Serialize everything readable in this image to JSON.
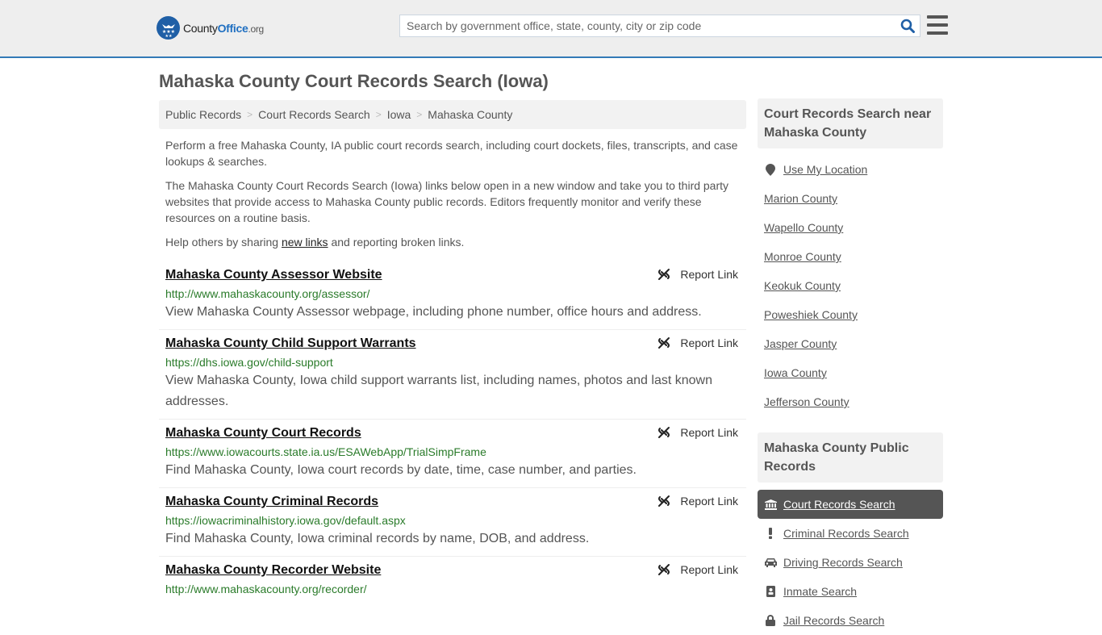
{
  "header": {
    "logo": {
      "county": "County",
      "office": "Office",
      "org": ".org"
    },
    "search": {
      "placeholder": "Search by government office, state, county, city or zip code",
      "value": ""
    },
    "colors": {
      "accent": "#337ab7",
      "logo_blue": "#1f5fa6"
    }
  },
  "page_title": "Mahaska County Court Records Search (Iowa)",
  "breadcrumb": [
    "Public Records",
    "Court Records Search",
    "Iowa",
    "Mahaska County"
  ],
  "intro": {
    "p1": "Perform a free Mahaska County, IA public court records search, including court dockets, files, transcripts, and case lookups & searches.",
    "p2": "The Mahaska County Court Records Search (Iowa) links below open in a new window and take you to third party websites that provide access to Mahaska County public records. Editors frequently monitor and verify these resources on a routine basis.",
    "p3_before": "Help others by sharing ",
    "p3_link": "new links",
    "p3_after": " and reporting broken links."
  },
  "report_label": "Report Link",
  "links": [
    {
      "title": "Mahaska County Assessor Website",
      "url": "http://www.mahaskacounty.org/assessor/",
      "desc": "View Mahaska County Assessor webpage, including phone number, office hours and address."
    },
    {
      "title": "Mahaska County Child Support Warrants",
      "url": "https://dhs.iowa.gov/child-support",
      "desc": "View Mahaska County, Iowa child support warrants list, including names, photos and last known addresses."
    },
    {
      "title": "Mahaska County Court Records",
      "url": "https://www.iowacourts.state.ia.us/ESAWebApp/TrialSimpFrame",
      "desc": "Find Mahaska County, Iowa court records by date, time, case number, and parties."
    },
    {
      "title": "Mahaska County Criminal Records",
      "url": "https://iowacriminalhistory.iowa.gov/default.aspx",
      "desc": "Find Mahaska County, Iowa criminal records by name, DOB, and address."
    },
    {
      "title": "Mahaska County Recorder Website",
      "url": "http://www.mahaskacounty.org/recorder/",
      "desc": ""
    }
  ],
  "sidebar": {
    "nearby_title": "Court Records Search near Mahaska County",
    "use_location": "Use My Location",
    "nearby": [
      "Marion County",
      "Wapello County",
      "Monroe County",
      "Keokuk County",
      "Poweshiek County",
      "Jasper County",
      "Iowa County",
      "Jefferson County"
    ],
    "public_title": "Mahaska County Public Records",
    "public": [
      {
        "label": "Court Records Search",
        "icon": "bank-icon",
        "active": true
      },
      {
        "label": "Criminal Records Search",
        "icon": "exclamation-icon",
        "active": false
      },
      {
        "label": "Driving Records Search",
        "icon": "car-icon",
        "active": false
      },
      {
        "label": "Inmate Search",
        "icon": "id-badge-icon",
        "active": false
      },
      {
        "label": "Jail Records Search",
        "icon": "lock-icon",
        "active": false
      }
    ]
  }
}
